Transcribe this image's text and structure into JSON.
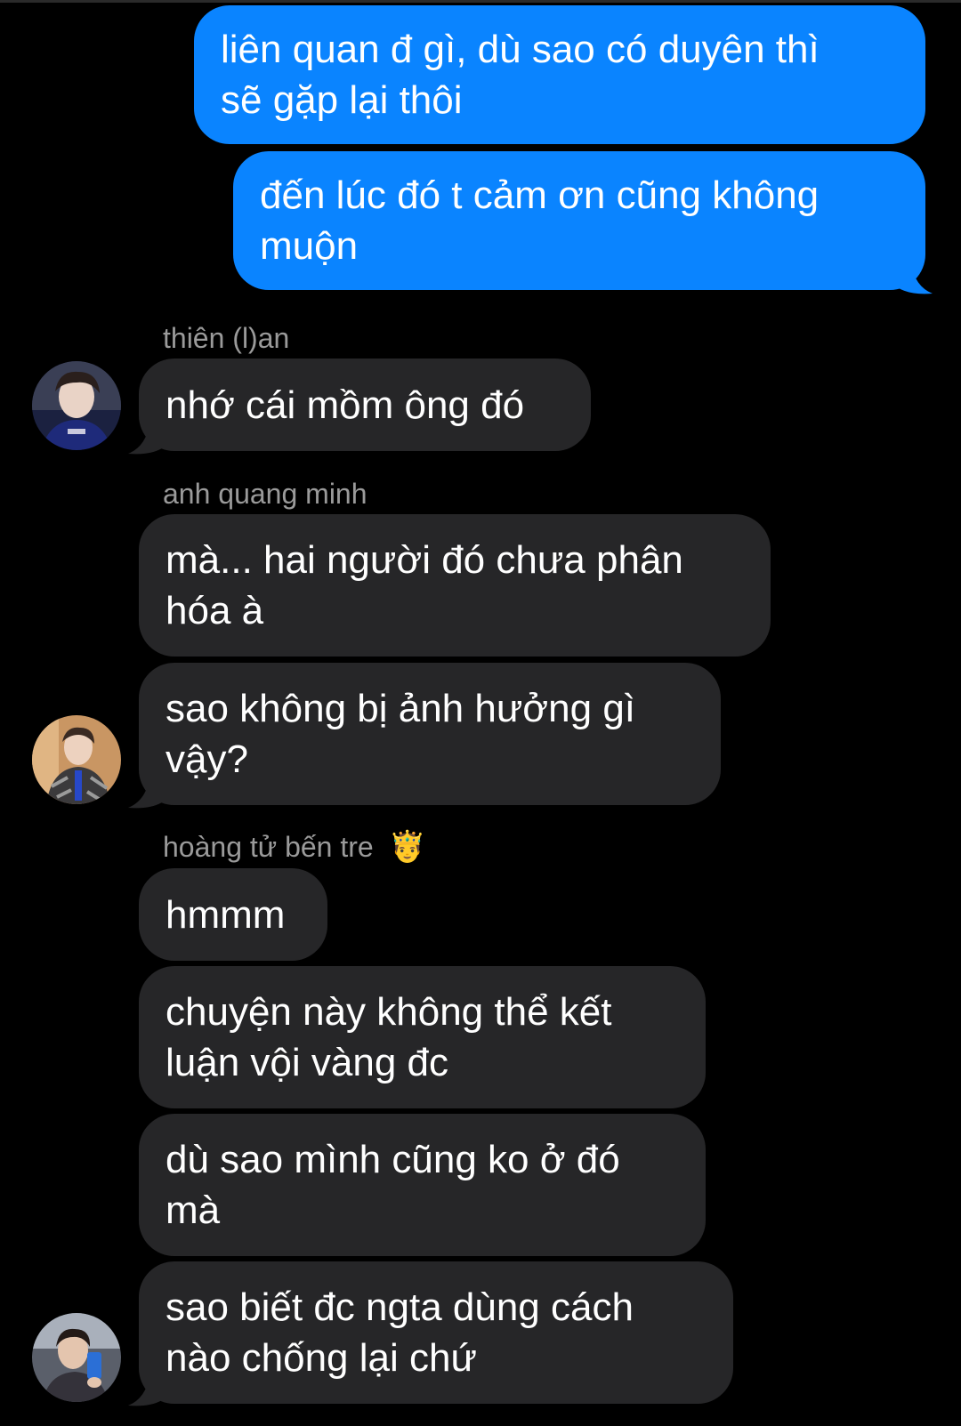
{
  "messages": {
    "m1": "liên quan đ gì, dù sao có duyên thì\nsẽ gặp lại thôi",
    "m2": "đến lúc đó t cảm ơn cũng không\nmuộn",
    "m3": "nhớ cái mồm ông đó",
    "m4": "mà... hai người đó chưa phân\nhóa à",
    "m5": "sao không bị ảnh hưởng gì\nvậy?",
    "m6": "hmmm",
    "m7": "chuyện này không thể kết\nluận vội vàng đc",
    "m8": "dù sao mình cũng ko ở đó\nmà",
    "m9": "sao biết đc ngta dùng cách\nnào chống lại chứ"
  },
  "senders": {
    "s1": "thiên (l)an",
    "s2": "anh quang minh",
    "s3": "hoàng tử bến tre",
    "s3_emoji": "🤴"
  },
  "colors": {
    "outgoing_bubble": "#0a84ff",
    "incoming_bubble": "#262628",
    "background": "#000000"
  }
}
